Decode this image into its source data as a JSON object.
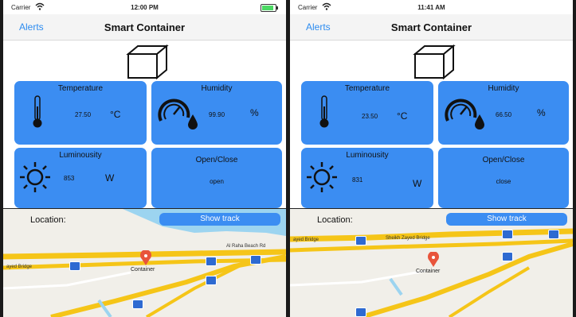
{
  "screens": [
    {
      "status": {
        "carrier": "Carrier",
        "time": "12:00 PM",
        "battery_level": 0.9
      },
      "nav": {
        "back": "Alerts",
        "title": "Smart Container"
      },
      "tiles": {
        "temperature": {
          "title": "Temperature",
          "value": "27.50",
          "unit": "°C"
        },
        "humidity": {
          "title": "Humidity",
          "value": "99.90",
          "unit": "%"
        },
        "luminosity": {
          "title": "Luminousity",
          "value": "853",
          "unit": "W"
        },
        "door": {
          "title": "Open/Close",
          "value": "open"
        }
      },
      "map": {
        "location_label": "Location:",
        "show_track": "Show track",
        "road_labels": [
          "Al Raha Beach Rd",
          "ayed Bridge"
        ],
        "pin_label": "Container"
      }
    },
    {
      "status": {
        "carrier": "Carrier",
        "time": "11:41 AM"
      },
      "nav": {
        "back": "Alerts",
        "title": "Smart Container"
      },
      "tiles": {
        "temperature": {
          "title": "Temperature",
          "value": "23.50",
          "unit": "°C"
        },
        "humidity": {
          "title": "Humidity",
          "value": "66.50",
          "unit": "%"
        },
        "luminosity": {
          "title": "Luminousity",
          "value": "831",
          "unit": "W"
        },
        "door": {
          "title": "Open/Close",
          "value": "close"
        }
      },
      "map": {
        "location_label": "Location:",
        "show_track": "Show track",
        "road_labels": [
          "Sheikh Zayed Bridge",
          "ayed Bridge"
        ],
        "pin_label": "Container"
      }
    }
  ],
  "colors": {
    "accent": "#3b8df2",
    "link": "#2d8cf0",
    "road": "#f5c518",
    "water": "#9cd4f0",
    "pin": "#e8543b"
  },
  "icons": [
    "box-icon",
    "thermometer-icon",
    "gauge-drop-icon",
    "sun-icon",
    "map-pin-icon",
    "cargo-marker-icon",
    "wifi-icon",
    "battery-icon"
  ]
}
